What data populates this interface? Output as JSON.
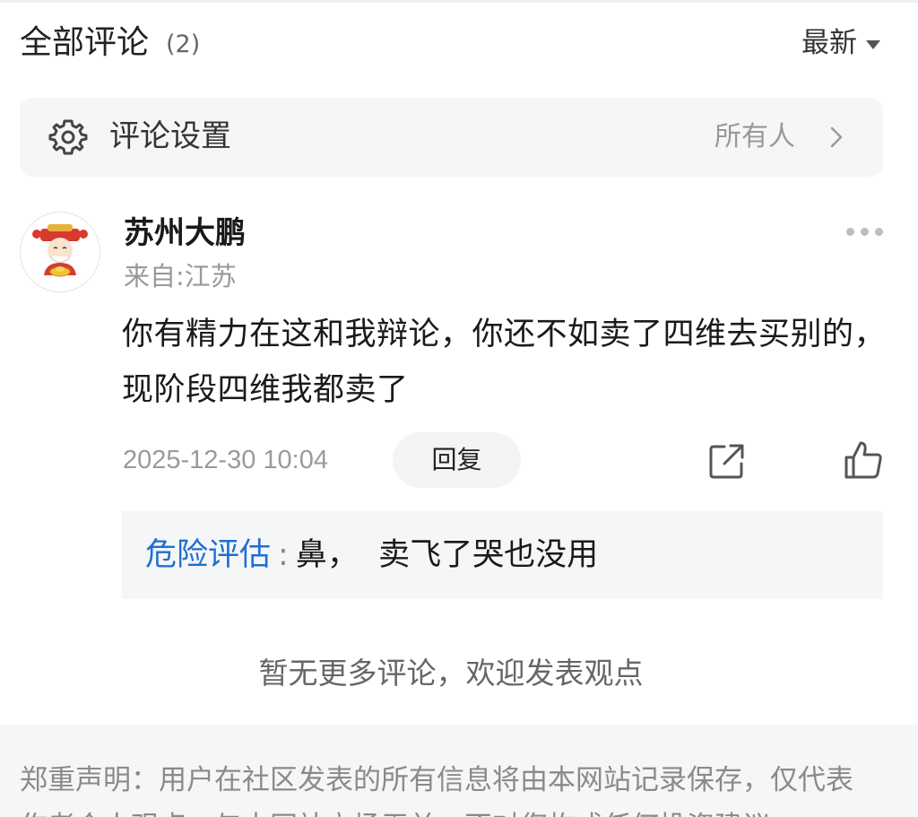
{
  "header": {
    "title": "全部评论",
    "count": "(2)",
    "sort_label": "最新"
  },
  "settings": {
    "label": "评论设置",
    "value": "所有人"
  },
  "comment": {
    "username": "苏州大鹏",
    "location": "来自:江苏",
    "text": "你有精力在这和我辩论，你还不如卖了四维去买别的，现阶段四维我都卖了",
    "timestamp": "2025-12-30 10:04",
    "reply_label": "回复",
    "replies": [
      {
        "author": "危险评估",
        "colon": ":",
        "content": "鼻，  卖飞了哭也没用"
      }
    ]
  },
  "footer": {
    "no_more": "暂无更多评论，欢迎发表观点",
    "disclaimer": "郑重声明：用户在社区发表的所有信息将由本网站记录保存，仅代表作者个人观点，与本网站立场无关，不对您构成任何投资建议"
  },
  "icons": {
    "settings": "gear-icon",
    "settings_arrow": "chevron-right-icon",
    "sort_arrow": "caret-down-icon",
    "more": "more-dots-icon",
    "share": "share-icon",
    "like": "thumbs-up-icon",
    "avatar": "fortune-god-avatar"
  },
  "colors": {
    "reply_author": "#1f6fd1",
    "muted_text": "#999999",
    "panel_bg": "#f5f6f8"
  }
}
